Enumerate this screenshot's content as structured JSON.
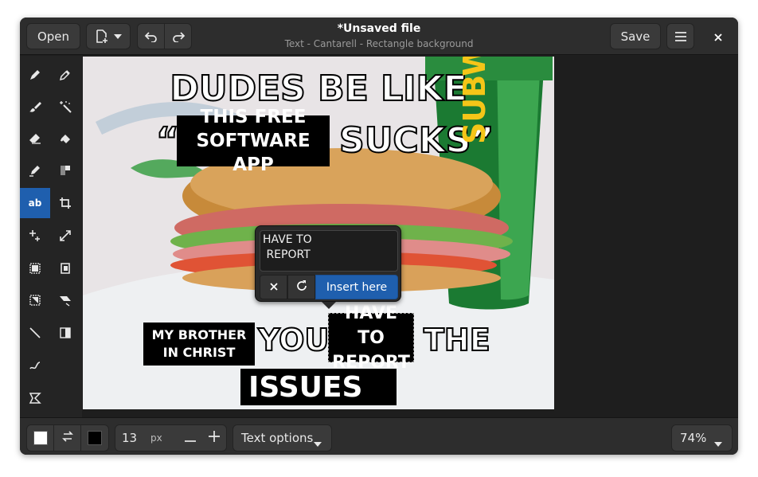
{
  "header": {
    "open_label": "Open",
    "title": "*Unsaved file",
    "subtitle": "Text - Cantarell - Rectangle background",
    "save_label": "Save"
  },
  "tools": [
    {
      "name": "pencil-tool",
      "icon": "pencil-icon"
    },
    {
      "name": "color-picker-tool",
      "icon": "eyedropper-icon"
    },
    {
      "name": "brush-tool",
      "icon": "brush-icon"
    },
    {
      "name": "magic-wand-tool",
      "icon": "magic-wand-icon"
    },
    {
      "name": "eraser-tool",
      "icon": "eraser-icon"
    },
    {
      "name": "fill-tool",
      "icon": "paint-bucket-icon"
    },
    {
      "name": "highlighter-tool",
      "icon": "highlighter-icon"
    },
    {
      "name": "rectangle-tool",
      "icon": "rectangle-icon"
    },
    {
      "name": "text-tool",
      "icon": "text-icon",
      "label": "ab",
      "active": true
    },
    {
      "name": "crop-tool",
      "icon": "crop-icon"
    },
    {
      "name": "scale-tool",
      "icon": "scale-icon"
    },
    {
      "name": "resize-tool",
      "icon": "resize-icon"
    },
    {
      "name": "select-tool",
      "icon": "select-icon"
    },
    {
      "name": "free-select-tool",
      "icon": "free-select-icon"
    },
    {
      "name": "color-select-tool",
      "icon": "color-select-icon"
    },
    {
      "name": "skew-tool",
      "icon": "skew-icon"
    },
    {
      "name": "line-tool",
      "icon": "line-icon"
    },
    {
      "name": "filters-tool",
      "icon": "filters-icon"
    },
    {
      "name": "curve-tool",
      "icon": "curve-icon"
    },
    {
      "name": "free-shape-tool",
      "icon": "free-shape-icon"
    }
  ],
  "meme": {
    "top_line": "DUDES BE LIKE",
    "quote_open": "“",
    "box1_line1": "THIS FREE",
    "box1_line2": "SOFTWARE APP",
    "sucks": "SUCKS”",
    "brother_line1": "MY BROTHER",
    "brother_line2": "IN CHRIST",
    "you": "YOU",
    "box2_line1": "HAVE TO",
    "box2_line2": "REPORT",
    "the": "THE",
    "issues": "ISSUES",
    "brand_text": "SUBWAY"
  },
  "popover": {
    "text_value": "HAVE TO\n REPORT",
    "insert_label": "Insert here"
  },
  "footer": {
    "main_color": "#ffffff",
    "secondary_color": "#000000",
    "size_value": "13",
    "size_unit": "px",
    "text_options_label": "Text options",
    "zoom_label": "74%"
  },
  "colors": {
    "accent": "#1f5fae",
    "header_bg": "#2d2d2d",
    "window_bg": "#1e1e1e"
  }
}
